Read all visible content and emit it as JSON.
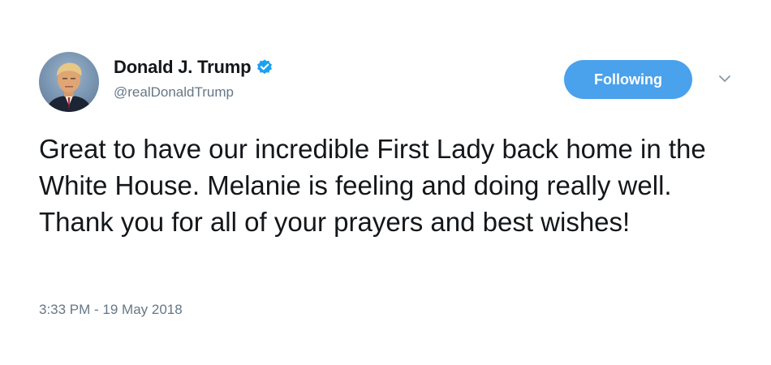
{
  "tweet": {
    "author": {
      "display_name": "Donald J. Trump",
      "handle": "@realDonaldTrump",
      "verified": true,
      "avatar_icon": "profile-photo"
    },
    "follow_button_label": "Following",
    "menu_icon": "chevron-down-icon",
    "text": "Great to have our incredible First Lady back home in the White House. Melanie is feeling and doing really well. Thank you for all of your prayers and best wishes!",
    "timestamp": "3:33 PM - 19 May 2018"
  },
  "colors": {
    "button_blue": "#4aa1ec",
    "verified_blue": "#1da1f2",
    "secondary_text": "#657786",
    "primary_text": "#14171a"
  }
}
